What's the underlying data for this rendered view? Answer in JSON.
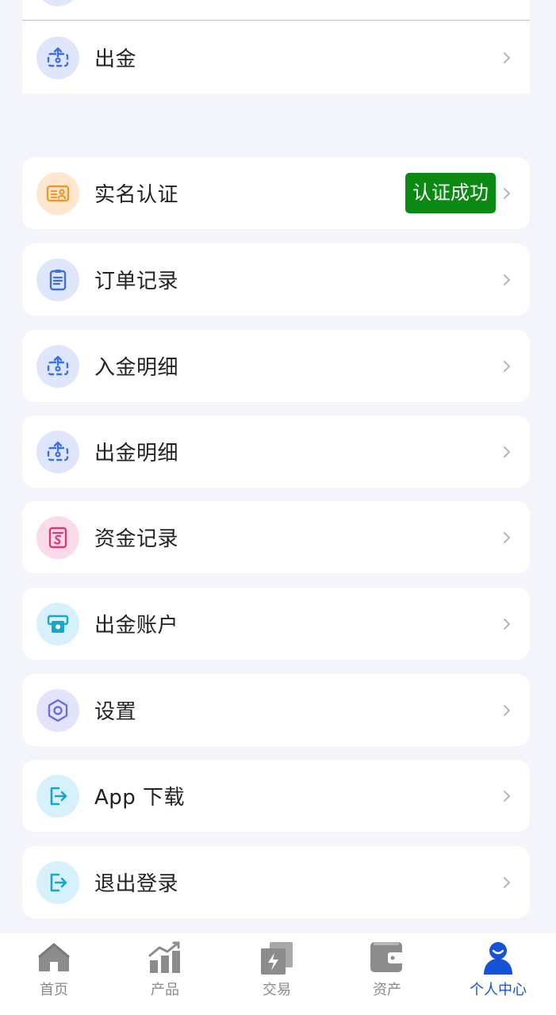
{
  "colors": {
    "background": "#f3f5fa",
    "badge_success": "#0a8a12",
    "tab_active": "#1652d6",
    "tab_inactive": "#8a8a8a"
  },
  "top_item": {
    "label": "出金",
    "icon": "withdraw-icon"
  },
  "menu": {
    "verify": {
      "label": "实名认证",
      "badge": "认证成功",
      "icon": "id-card-icon"
    },
    "orders": {
      "label": "订单记录",
      "icon": "clipboard-icon"
    },
    "deposit_details": {
      "label": "入金明细",
      "icon": "deposit-icon"
    },
    "withdraw_details": {
      "label": "出金明细",
      "icon": "withdraw-icon"
    },
    "fund_records": {
      "label": "资金记录",
      "icon": "money-record-icon"
    },
    "withdraw_account": {
      "label": "出金账户",
      "icon": "cash-icon"
    },
    "settings": {
      "label": "设置",
      "icon": "gear-icon"
    },
    "app_download": {
      "label": "App 下载",
      "icon": "exit-arrow-icon"
    },
    "logout": {
      "label": "退出登录",
      "icon": "exit-arrow-icon"
    }
  },
  "tabbar": {
    "home": "首页",
    "products": "产品",
    "trade": "交易",
    "assets": "资产",
    "profile": "个人中心",
    "active": "profile"
  }
}
